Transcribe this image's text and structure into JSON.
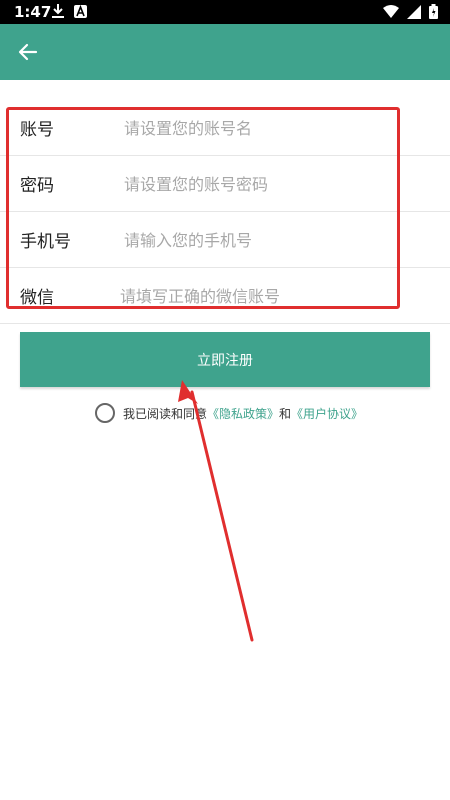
{
  "status_bar": {
    "time": "1:47",
    "icons": [
      "download-icon",
      "app-a-icon",
      "wifi-icon",
      "signal-icon",
      "battery-icon"
    ]
  },
  "app_bar": {
    "back_icon": "arrow-left-icon",
    "color": "#3fa38d"
  },
  "form": {
    "rows": [
      {
        "label": "账号",
        "placeholder": "请设置您的账号名",
        "value": ""
      },
      {
        "label": "密码",
        "placeholder": "请设置您的账号密码",
        "value": ""
      },
      {
        "label": "手机号",
        "placeholder": "请输入您的手机号",
        "value": ""
      },
      {
        "label": "微信",
        "placeholder": "请填写正确的微信账号",
        "value": ""
      }
    ]
  },
  "register_button": {
    "label": "立即注册"
  },
  "agreement": {
    "prefix": "我已阅读和同意",
    "privacy_link": "《隐私政策》",
    "connector": "和",
    "user_link": "《用户协议》",
    "checked": false
  },
  "annotations": {
    "highlight_color": "#e02e2e"
  }
}
